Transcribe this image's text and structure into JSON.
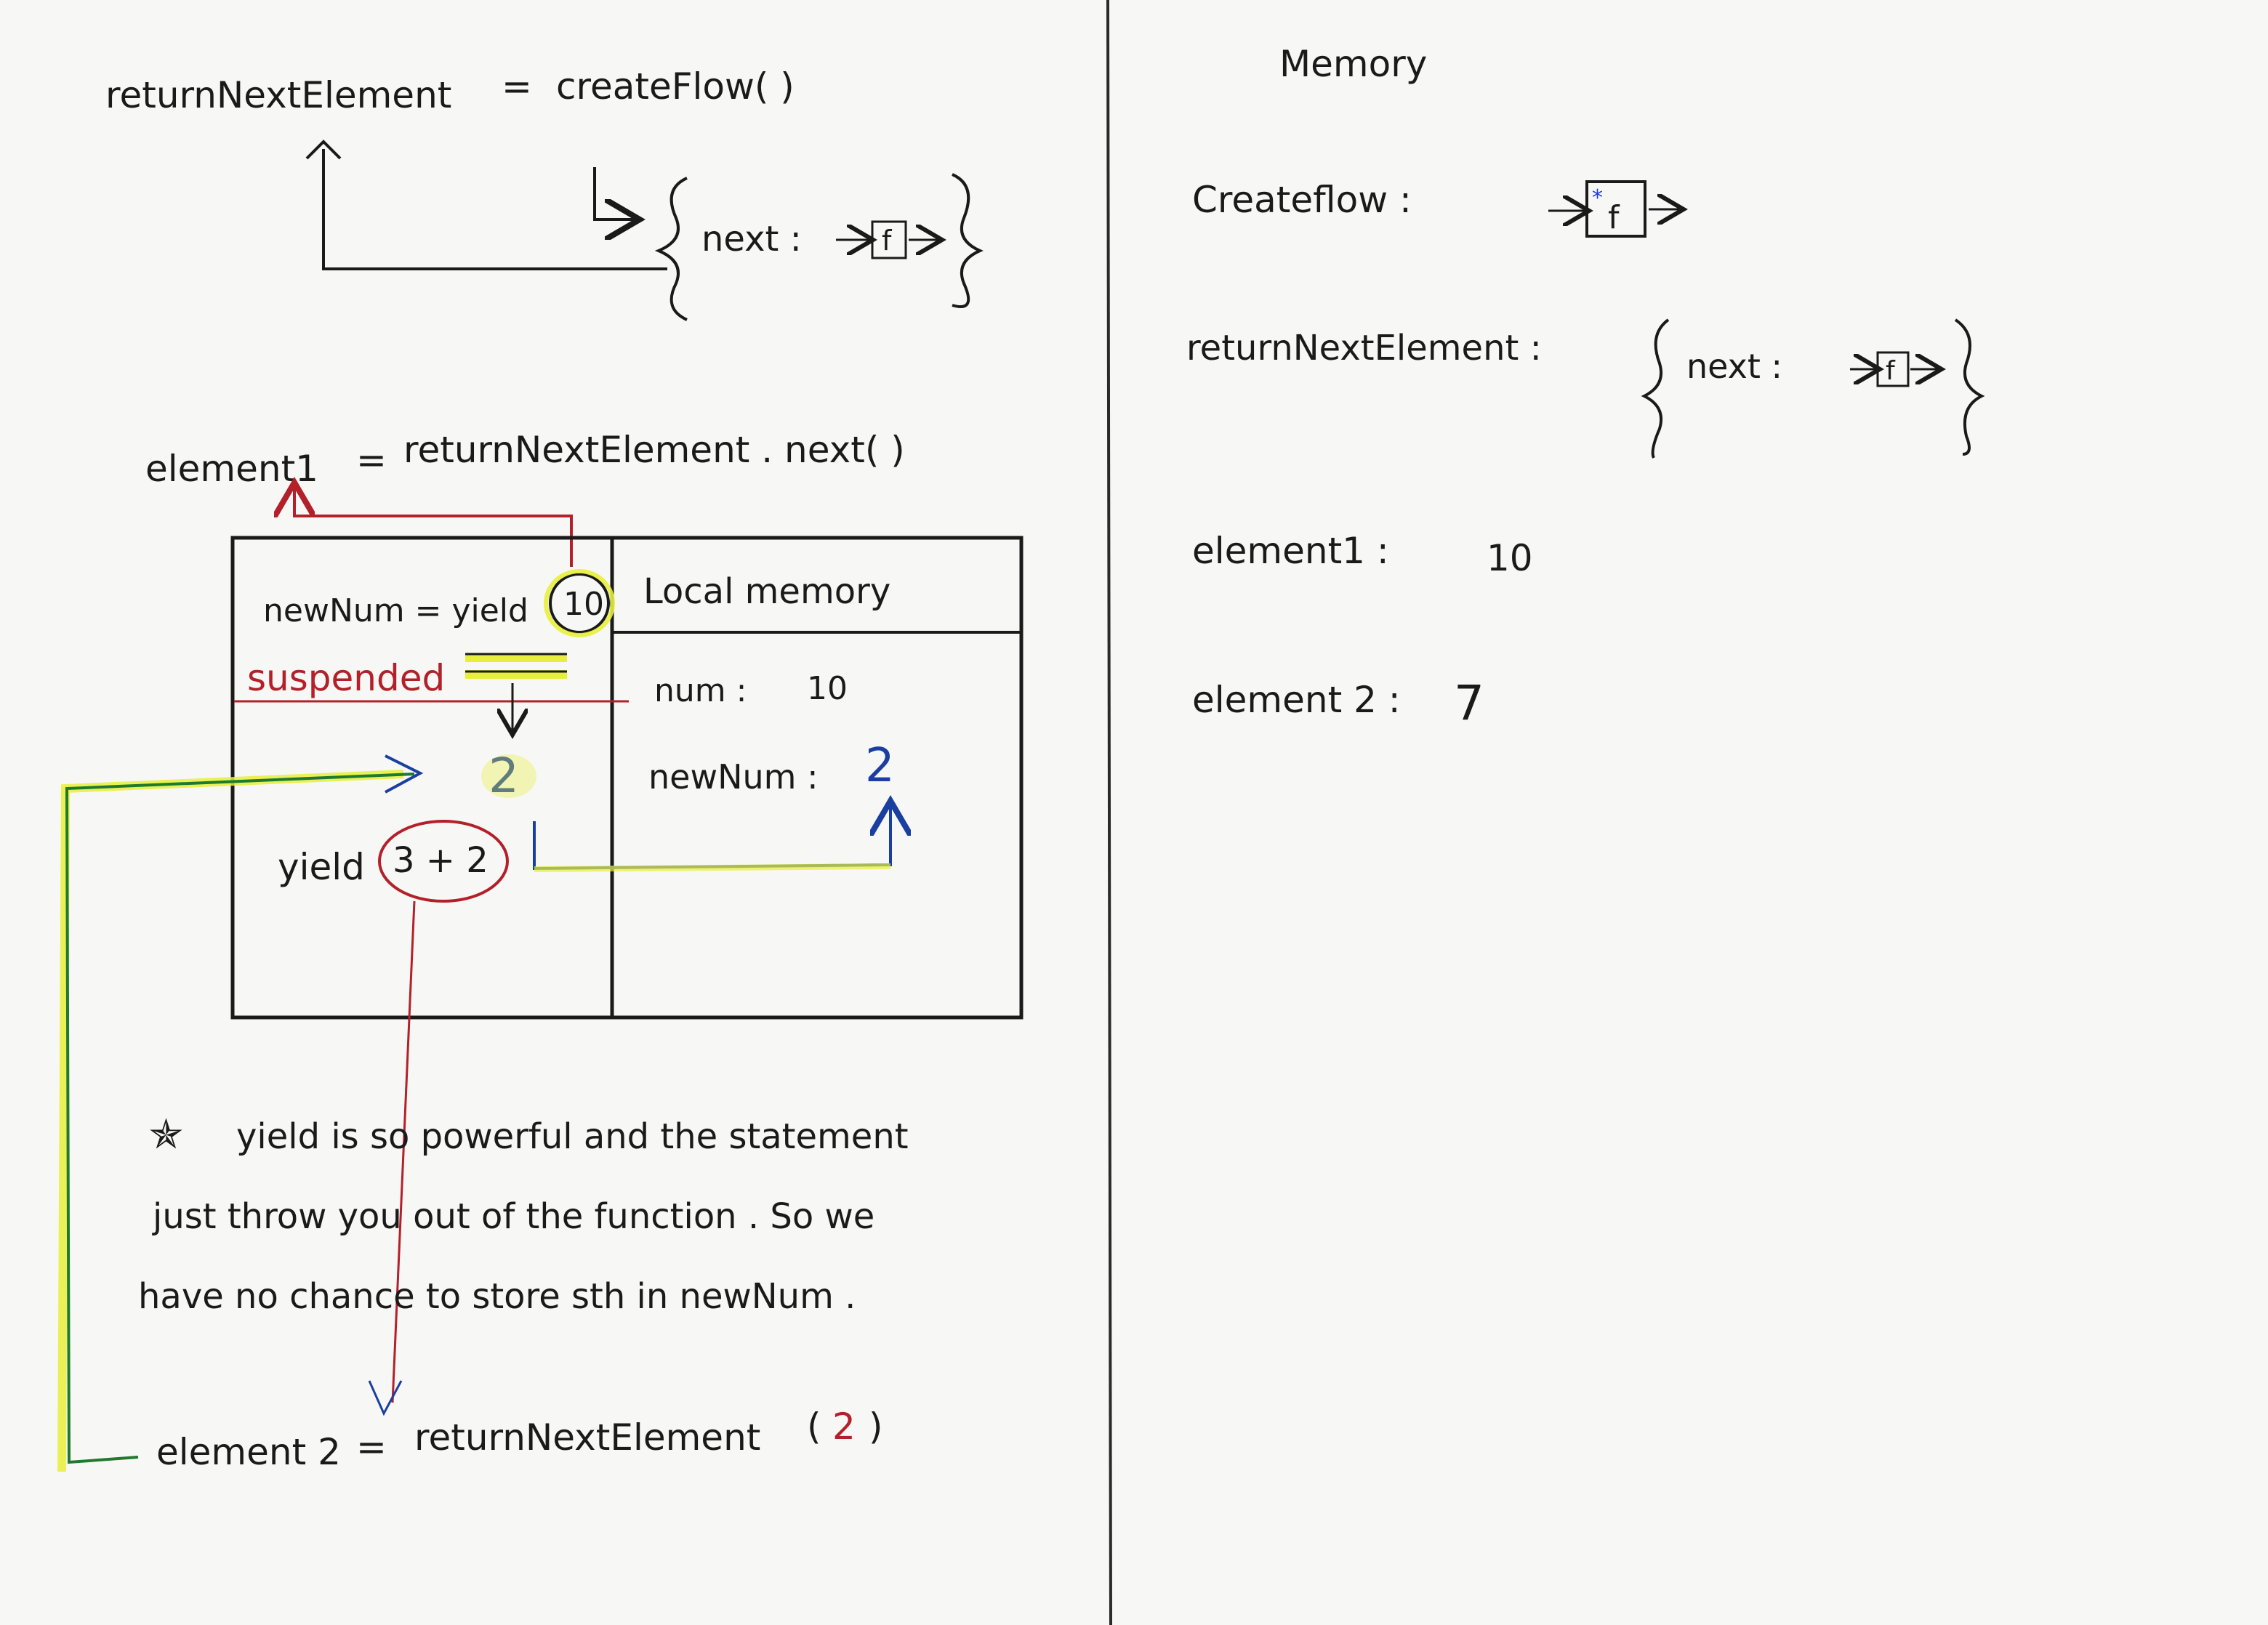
{
  "left": {
    "line1": {
      "lhs": "returnNextElement",
      "eq": "=",
      "rhs": "createFlow( )"
    },
    "obj_top": {
      "label": "next :",
      "fn": "f"
    },
    "line2": {
      "lhs": "element1",
      "eq": "=",
      "rhs": "returnNextElement . next( )"
    },
    "box": {
      "row1_code": "newNum = yield",
      "row1_value": "10",
      "suspended": "suspended",
      "value_two": "2",
      "row2_code": "yield",
      "row2_expr": "3 + 2"
    },
    "local_memory": {
      "title": "Local   memory",
      "num_label": "num :",
      "num_value": "10",
      "newnum_label": "newNum :",
      "newnum_value": "2"
    },
    "note": {
      "star": "✯",
      "line1": "yield is so powerful and the statement",
      "line2": "just throw you out of the function . So we",
      "line3": "have no chance to store sth in newNum ."
    },
    "bottom": {
      "lhs": "element 2",
      "eq": "=",
      "rhs": "returnNextElement",
      "paren_open": "(",
      "arg": "2",
      "paren_close": ")"
    }
  },
  "right": {
    "title": "Memory",
    "createflow_label": "Createflow :",
    "createflow_fn": "f",
    "rne_label": "returnNextElement :",
    "rne_next_label": "next :",
    "rne_fn": "f",
    "element1_label": "element1 :",
    "element1_value": "10",
    "element2_label": "element 2 :",
    "element2_value": "7"
  },
  "colors": {
    "ink": "#1a1a1a",
    "red": "#b3202a",
    "blue": "#1a3fa0",
    "yellow": "#e8ef3a",
    "green": "#1d7a2e",
    "star_blue": "#1f3fd8"
  }
}
